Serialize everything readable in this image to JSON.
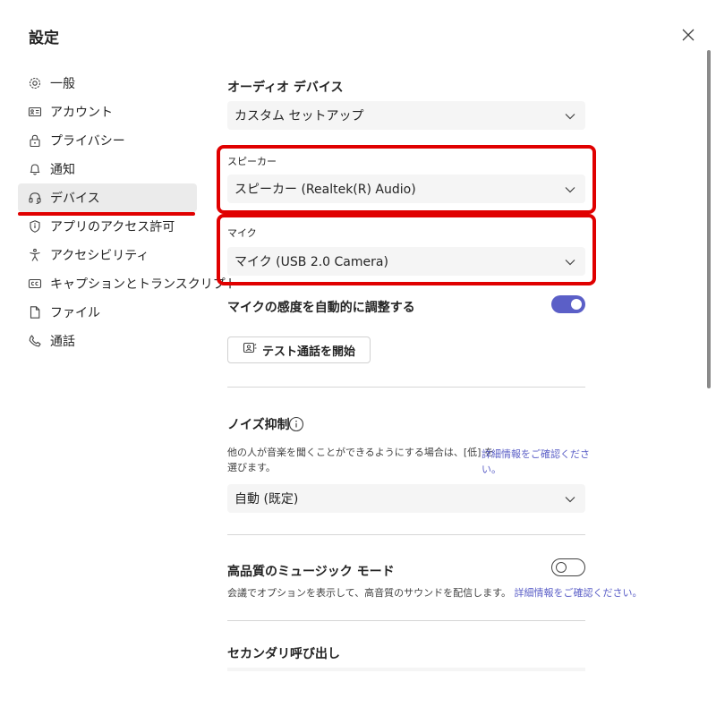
{
  "header": {
    "title": "設定"
  },
  "sidebar": {
    "items": [
      {
        "label": "一般",
        "icon": "gear-icon"
      },
      {
        "label": "アカウント",
        "icon": "id-card-icon"
      },
      {
        "label": "プライバシー",
        "icon": "lock-icon"
      },
      {
        "label": "通知",
        "icon": "bell-icon"
      },
      {
        "label": "デバイス",
        "icon": "headset-icon",
        "active": true
      },
      {
        "label": "アプリのアクセス許可",
        "icon": "shield-icon"
      },
      {
        "label": "アクセシビリティ",
        "icon": "accessibility-icon"
      },
      {
        "label": "キャプションとトランスクリプト",
        "icon": "cc-icon"
      },
      {
        "label": "ファイル",
        "icon": "file-icon"
      },
      {
        "label": "通話",
        "icon": "phone-icon"
      }
    ]
  },
  "audio": {
    "heading": "オーディオ デバイス",
    "device_value": "カスタム セットアップ",
    "speaker_label": "スピーカー",
    "speaker_value": "スピーカー (Realtek(R) Audio)",
    "mic_label": "マイク",
    "mic_value": "マイク (USB 2.0 Camera)",
    "auto_adjust_label": "マイクの感度を自動的に調整する",
    "auto_adjust_on": true,
    "test_call_label": "テスト通話を開始"
  },
  "noise": {
    "heading": "ノイズ抑制",
    "desc_line1": "他の人が音楽を聞くことができるようにする場合は、[低] を",
    "desc_line2": "選びます。",
    "link_line1": "詳細情報をご確認くださ",
    "link_line2": "い。",
    "value": "自動 (既定)"
  },
  "music": {
    "heading": "高品質のミュージック モード",
    "enabled": false,
    "desc": "会議でオプションを表示して、高音質のサウンドを配信します。",
    "link": "詳細情報をご確認ください。"
  },
  "secondary": {
    "heading": "セカンダリ呼び出し"
  },
  "colors": {
    "accent": "#5b5fc7",
    "highlight": "#e00000"
  }
}
